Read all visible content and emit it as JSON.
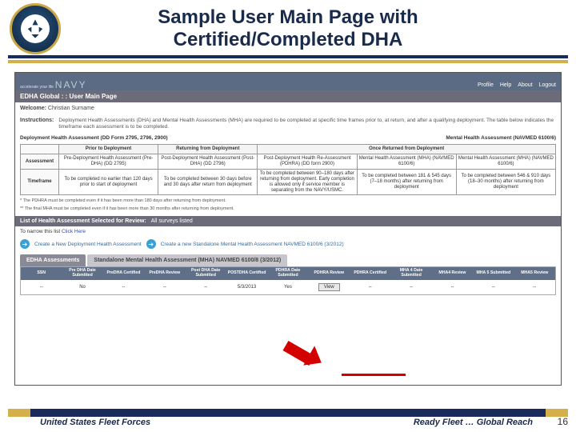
{
  "slide": {
    "title_l1": "Sample User Main Page with",
    "title_l2": "Certified/Completed DHA",
    "footer_left": "United States Fleet Forces",
    "footer_right": "Ready Fleet … Global Reach",
    "page_number": "16"
  },
  "app": {
    "brand": "NAVY",
    "tagline": "accelerate your life",
    "top_links": [
      "Profile",
      "Help",
      "About",
      "Logout"
    ],
    "page_path": "EDHA Global : : User Main Page",
    "welcome_label": "Welcome:",
    "welcome_name": "Christian Surname",
    "instructions_label": "Instructions:",
    "instructions_text": "Deployment Health Assessments (DHA) and Mental Health Assessments (MHA) are required to be completed at specific time frames prior to, at return, and after a qualifying deployment. The table below indicates the timeframe each assessment is to be completed.",
    "sec_left": "Deployment Health Assessment (DD Form 2795, 2796, 2900)",
    "sec_right": "Mental Health Assessment (NAVMED 6100/6)"
  },
  "timeline": {
    "headers": {
      "row_assessment": "Assessment",
      "row_timeframe": "Timeframe",
      "prior": "Prior to Deployment",
      "returning": "Returning from Deployment",
      "once": "Once Returned from Deployment"
    },
    "cols": [
      {
        "name": "Pre-Deployment Health Assessment (Pre-DHA) (DD 2795)",
        "time": "To be completed no earlier than 120 days prior to start of deployment"
      },
      {
        "name": "Post-Deployment Health Assessment (Post-DHA) (DD 2796)",
        "time": "To be completed between 30 days before and 30 days after return from deployment"
      },
      {
        "name": "Post-Deployment Health Re-Assessment (PDHRA) (DD form 2900)",
        "time": "To be completed between 90–180 days after returning from deployment. Early completion is allowed only if service member is separating from the NAVY/USMC."
      },
      {
        "name": "Mental Health Assessment (MHA) (NAVMED 6100/6)",
        "time": "To be completed between 181 & 545 days (7–18 months) after returning from deployment"
      },
      {
        "name": "Mental Health Assessment (MHA) (NAVMED 6100/6)",
        "time": "To be completed between 546 & 910 days (18–30 months) after returning from deployment"
      }
    ],
    "footnotes": [
      "* The PDHRA must be completed even if it has been more than 180 days after returning from deployment.",
      "** The final MHA must be completed even if it has been more than 30 months after returning from deployment."
    ]
  },
  "review": {
    "header": "List of Health Assessment Selected for Review:",
    "all": "All surveys listed",
    "narrow_label": "To narrow this list",
    "narrow_link": "Click Here",
    "action1": "Create a New Deployment Health Assessment",
    "action2": "Create a new Standalone Mental Health Assessment NAVMED 6100/6 (3/2012)"
  },
  "tabs": {
    "active": "EDHA Assessments",
    "inactive": "Standalone Mental Health Assessment (MHA) NAVMED 6100/8 (3/2012)"
  },
  "table": {
    "headers": [
      "SSN",
      "Pre DHA Date Submitted",
      "PreDHA Certified",
      "PreDHA Review",
      "Post DHA Date Submitted",
      "POSTDHA Certified",
      "PDHRA Date Submitted",
      "PDHRA Review",
      "PDHRA Certified",
      "MHA 4 Date Submitted",
      "MHA4 Review",
      "MHA 5 Submitted",
      "MHA5 Review"
    ],
    "row": {
      "ssn": "--",
      "pre_date": "No",
      "pre_cert": "--",
      "pre_rev": "--",
      "post_date": "--",
      "post_cert": "5/3/2013",
      "pdhra_date": "Yes",
      "pdhra_rev": "View",
      "pdhra_cert": "--",
      "mha4_date": "--",
      "mha4_rev": "--",
      "mha5_sub": "--",
      "mha5_rev": "--"
    }
  }
}
